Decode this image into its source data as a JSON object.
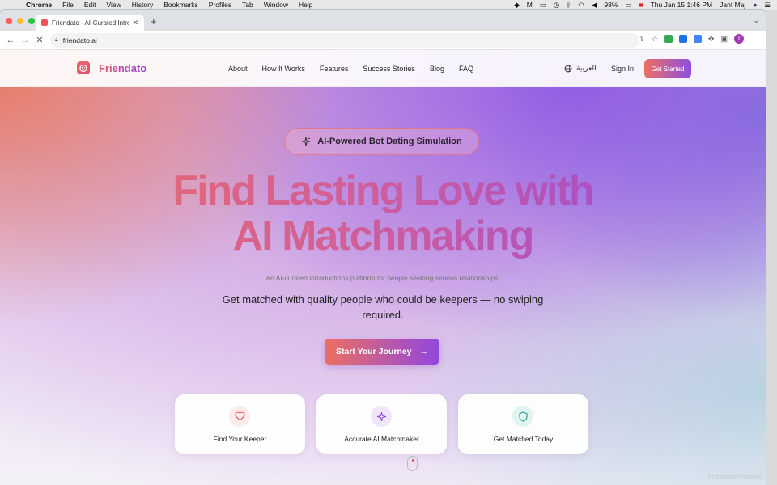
{
  "menubar": {
    "app": "Chrome",
    "items": [
      "File",
      "Edit",
      "View",
      "History",
      "Bookmarks",
      "Profiles",
      "Tab",
      "Window",
      "Help"
    ],
    "battery": "98%",
    "datetime": "Thu Jan 15  1:46 PM",
    "user": "Jant Maj"
  },
  "browser": {
    "tab_title": "Friendato - AI-Curated Introdu",
    "url": "friendato.ai",
    "profile_initial": "T"
  },
  "nav": {
    "brand": "Friendato",
    "links": [
      "About",
      "How It Works",
      "Features",
      "Success Stories",
      "Blog",
      "FAQ"
    ],
    "language": "العربية",
    "sign_in": "Sign In",
    "get_started": "Get Started"
  },
  "hero": {
    "badge": "AI-Powered Bot Dating Simulation",
    "headline_line1": "Find Lasting Love with",
    "headline_line2": "AI Matchmaking",
    "subtext_small": "An AI-curated introductions platform for people seeking serious relationships.",
    "subtitle": "Get matched with quality people who could be keepers — no swiping required.",
    "cta": "Start Your Journey"
  },
  "features": [
    {
      "label": "Find Your Keeper",
      "icon": "heart-icon",
      "color": "#e8565a"
    },
    {
      "label": "Accurate AI Matchmaker",
      "icon": "sparkles-icon",
      "color": "#8a45d8"
    },
    {
      "label": "Get Matched Today",
      "icon": "shield-icon",
      "color": "#1f9c8a"
    }
  ],
  "watermark": "Screenshot Protected"
}
